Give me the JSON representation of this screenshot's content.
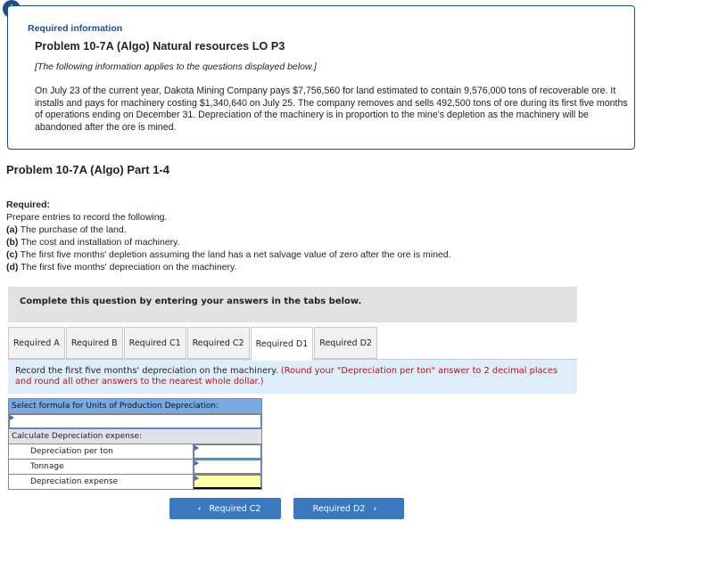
{
  "alert_icon": "!",
  "info": {
    "label": "Required information",
    "title": "Problem 10-7A (Algo) Natural resources LO P3",
    "note": "[The following information applies to the questions displayed below.]",
    "paragraph": "On July 23 of the current year, Dakota Mining Company pays $7,756,560 for land estimated to contain 9,576,000 tons of recoverable ore. It installs and pays for machinery costing $1,340,640 on July 25. The company removes and sells 492,500 tons of ore during its first five months of operations ending on December 31. Depreciation of the machinery is in proportion to the mine's depletion as the machinery will be abandoned after the ore is mined."
  },
  "part_title": "Problem 10-7A (Algo) Part 1-4",
  "required": {
    "heading": "Required:",
    "intro": "Prepare entries to record the following.",
    "items": [
      {
        "marker": "(a)",
        "text": "The purchase of the land."
      },
      {
        "marker": "(b)",
        "text": "The cost and installation of machinery."
      },
      {
        "marker": "(c)",
        "text": "The first five months' depletion assuming the land has a net salvage value of zero after the ore is mined."
      },
      {
        "marker": "(d)",
        "text": "The first five months' depreciation on the machinery."
      }
    ]
  },
  "instructions": "Complete this question by entering your answers in the tabs below.",
  "tabs": [
    {
      "label": "Required A",
      "active": false
    },
    {
      "label": "Required B",
      "active": false
    },
    {
      "label": "Required C1",
      "active": false
    },
    {
      "label": "Required C2",
      "active": false
    },
    {
      "label": "Required D1",
      "active": true
    },
    {
      "label": "Required D2",
      "active": false
    }
  ],
  "panel": {
    "description": "Record the first five months' depreciation on the machinery.",
    "hint": "(Round your \"Depreciation per ton\" answer to 2 decimal places and round all other answers to the nearest whole dollar.)"
  },
  "calc": {
    "formula_header": "Select formula for Units of Production Depreciation:",
    "formula_value": "",
    "calc_header": "Calculate Depreciation expense:",
    "rows": [
      {
        "label": "Depreciation per ton",
        "value": ""
      },
      {
        "label": "Tonnage",
        "value": ""
      },
      {
        "label": "Depreciation expense",
        "value": ""
      }
    ]
  },
  "nav": {
    "prev_label": "Required C2",
    "next_label": "Required D2",
    "prev_icon": "‹",
    "next_icon": "›"
  },
  "colors": {
    "brand_blue": "#1d4f87",
    "button_blue": "#3a78bf",
    "hint_red": "#b0141c",
    "panel_bg": "#ddeefa",
    "header_blue": "#79a9e0",
    "result_yellow": "#ffffa6"
  }
}
